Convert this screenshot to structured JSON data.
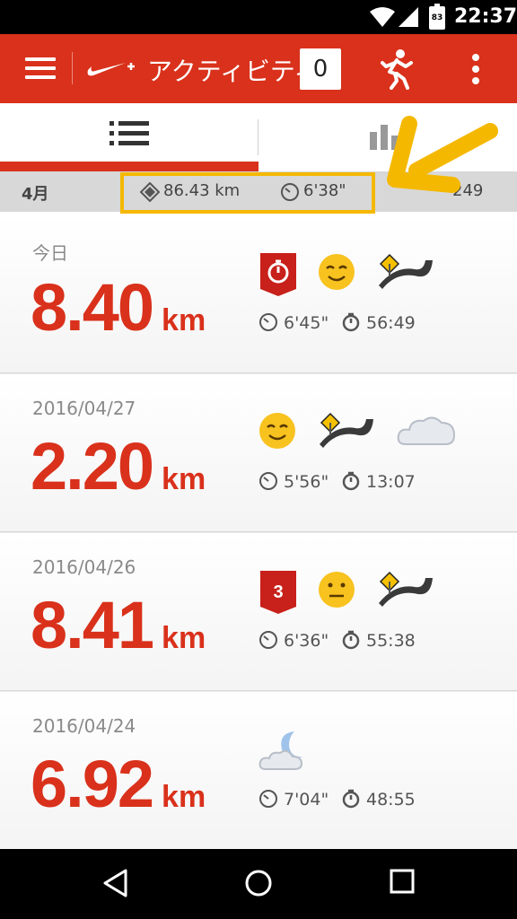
{
  "status_bar": {
    "time": "22:37",
    "battery_level": "83"
  },
  "app_bar": {
    "title": "アクティビティ",
    "badge_count": "0"
  },
  "tabs": [
    {
      "id": "list",
      "icon": "list-icon",
      "selected": true
    },
    {
      "id": "chart",
      "icon": "bar-chart-icon",
      "selected": false
    }
  ],
  "summary": {
    "month": "4月",
    "distance": "86.43 km",
    "pace": "6'38\"",
    "calories": "249"
  },
  "activities": [
    {
      "date": "今日",
      "distance": "8.40",
      "unit": "km",
      "pace": "6'45\"",
      "duration": "56:49",
      "emblems": [
        "stopwatch-badge-icon",
        "smiley-icon",
        "road-icon"
      ]
    },
    {
      "date": "2016/04/27",
      "distance": "2.20",
      "unit": "km",
      "pace": "5'56\"",
      "duration": "13:07",
      "emblems": [
        "smiley-icon",
        "road-icon",
        "cloud-icon"
      ]
    },
    {
      "date": "2016/04/26",
      "distance": "8.41",
      "unit": "km",
      "pace": "6'36\"",
      "duration": "55:38",
      "emblems": [
        "rank-3-badge-icon",
        "neutral-face-icon",
        "road-icon"
      ],
      "badge_text": "3"
    },
    {
      "date": "2016/04/24",
      "distance": "6.92",
      "unit": "km",
      "pace": "7'04\"",
      "duration": "48:55",
      "emblems": [
        "moon-cloud-icon"
      ]
    }
  ],
  "colors": {
    "brand_red": "#d9311b",
    "highlight_yellow": "#f5b800",
    "summary_gray": "#d8d8d8"
  }
}
